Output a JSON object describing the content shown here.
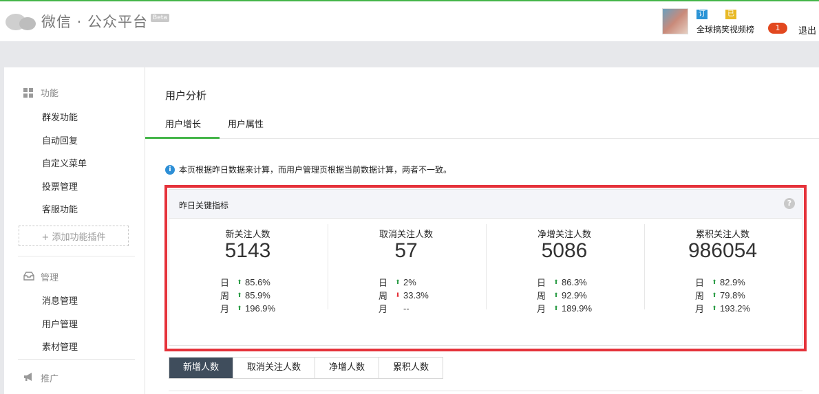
{
  "header": {
    "app_title": "微信 · 公众平台",
    "beta": "Beta",
    "tag_subscription": "订阅号",
    "tag_verified": "已认证",
    "account_name": "全球搞笑视频榜",
    "notification_count": "1",
    "logout": "退出"
  },
  "sidebar": {
    "section_features": "功能",
    "features": [
      "群发功能",
      "自动回复",
      "自定义菜单",
      "投票管理",
      "客服功能"
    ],
    "add_plugin": "+ 添加功能插件",
    "section_manage": "管理",
    "manage": [
      "消息管理",
      "用户管理",
      "素材管理"
    ],
    "section_promote": "推广"
  },
  "main": {
    "page_title": "用户分析",
    "tabs": [
      "用户增长",
      "用户属性"
    ],
    "notice": "本页根据昨日数据来计算，而用户管理页根据当前数据计算，两者不一致。",
    "kpi_title": "昨日关键指标",
    "kpis": [
      {
        "label": "新关注人数",
        "value": "5143",
        "rows": [
          {
            "period": "日",
            "direction": "up",
            "change": "85.6%"
          },
          {
            "period": "周",
            "direction": "up",
            "change": "85.9%"
          },
          {
            "period": "月",
            "direction": "up",
            "change": "196.9%"
          }
        ]
      },
      {
        "label": "取消关注人数",
        "value": "57",
        "rows": [
          {
            "period": "日",
            "direction": "up",
            "change": "2%"
          },
          {
            "period": "周",
            "direction": "down",
            "change": "33.3%"
          },
          {
            "period": "月",
            "direction": "none",
            "change": "--"
          }
        ]
      },
      {
        "label": "净增关注人数",
        "value": "5086",
        "rows": [
          {
            "period": "日",
            "direction": "up",
            "change": "86.3%"
          },
          {
            "period": "周",
            "direction": "up",
            "change": "92.9%"
          },
          {
            "period": "月",
            "direction": "up",
            "change": "189.9%"
          }
        ]
      },
      {
        "label": "累积关注人数",
        "value": "986054",
        "rows": [
          {
            "period": "日",
            "direction": "up",
            "change": "82.9%"
          },
          {
            "period": "周",
            "direction": "up",
            "change": "79.8%"
          },
          {
            "period": "月",
            "direction": "up",
            "change": "193.2%"
          }
        ]
      }
    ],
    "metric_tabs": [
      "新增人数",
      "取消关注人数",
      "净增人数",
      "累积人数"
    ],
    "active_metric_tab": "新增人数"
  },
  "colors": {
    "brand_green": "#44b549",
    "highlight_red": "#e5323a",
    "up_green": "#2e9d48",
    "down_red": "#e5323a",
    "active_tab_bg": "#3f4d5c"
  }
}
